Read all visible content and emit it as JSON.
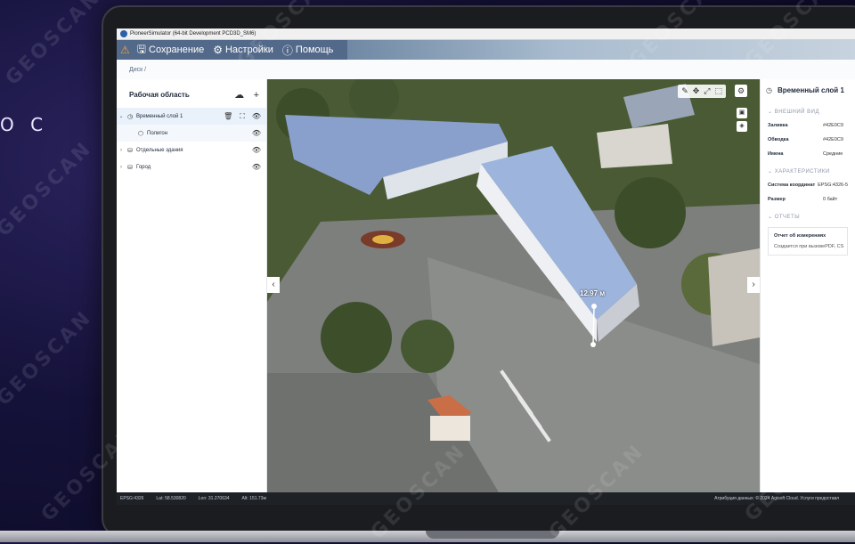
{
  "hero": {
    "text": "О С"
  },
  "watermark": "GEOSCAN",
  "window": {
    "title": "PioneerSimulator (64-bit Development PCD3D_SM6)"
  },
  "menu": {
    "save": "Сохранение",
    "settings": "Настройки",
    "help": "Помощь"
  },
  "breadcrumb": "Диск /",
  "workspace": {
    "title": "Рабочая область",
    "tree": [
      {
        "label": "Временный слой 1"
      },
      {
        "label": "Полигон"
      },
      {
        "label": "Отдельные здания"
      },
      {
        "label": "Город"
      }
    ]
  },
  "viewport": {
    "measurement": "12.97 м"
  },
  "properties": {
    "title": "Временный слой 1",
    "sections": {
      "appearance": "ВНЕШНИЙ ВИД",
      "characteristics": "ХАРАКТЕРИСТИКИ",
      "reports": "ОТЧЕТЫ"
    },
    "appearance_rows": [
      {
        "k": "Заливка",
        "v": "#42E0C9"
      },
      {
        "k": "Обводка",
        "v": "#42E0C9"
      },
      {
        "k": "Имена",
        "v": "Средние"
      }
    ],
    "characteristic_rows": [
      {
        "k": "Система координат",
        "v": "EPSG:4326-5"
      },
      {
        "k": "Размер",
        "v": "0 байт"
      }
    ],
    "report": {
      "title": "Отчет об измерениях",
      "created": "Создается при вызове",
      "format": "PDF, CS"
    }
  },
  "status": {
    "epsg": "EPSG:4326",
    "lat": "Lat: 58.530820",
    "lon": "Lon: 31.270634",
    "alt": "Alt: 151.73м",
    "attribution": "Атрибуция данных: © 2024 Agisoft Cloud. Услуги предоставл"
  },
  "colors": {
    "accent": "#53698a",
    "fill": "#42E0C9"
  }
}
